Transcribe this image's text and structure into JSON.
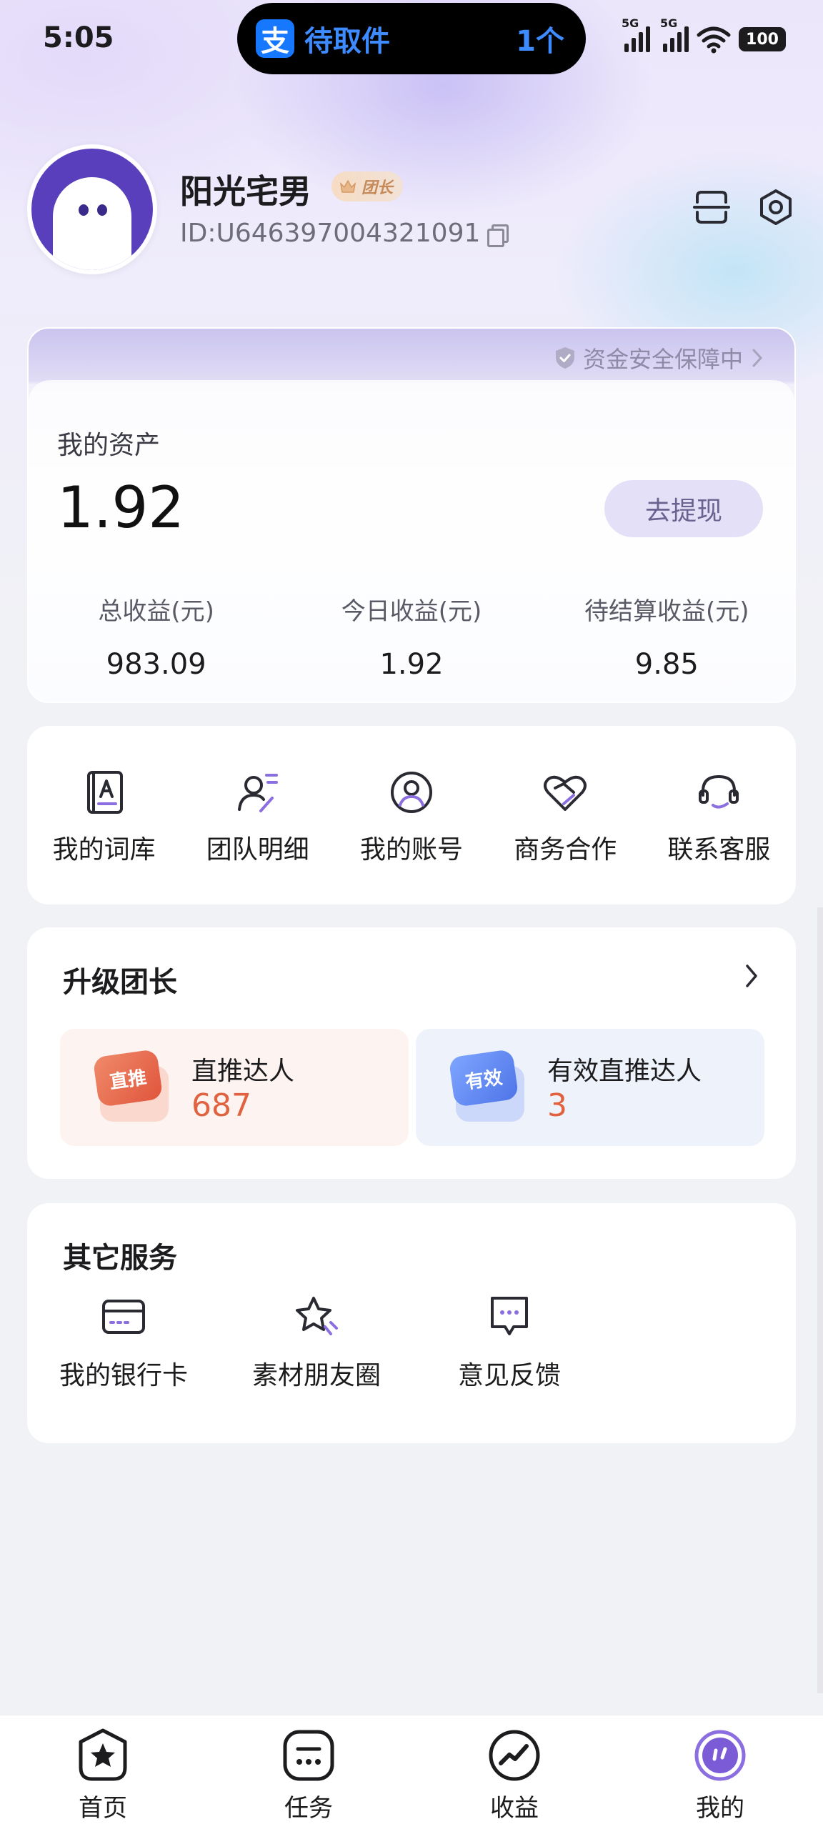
{
  "status_bar": {
    "time": "5:05",
    "island_title": "待取件",
    "island_count": "1个",
    "alipay_logo": "支",
    "network_5g_1": "5G",
    "network_5g_2": "5G",
    "battery": "100"
  },
  "profile": {
    "username": "阳光宅男",
    "badge": "团长",
    "user_id": "ID:U646397004321091"
  },
  "assets": {
    "safety_text": "资金安全保障中",
    "label": "我的资产",
    "value": "1.92",
    "withdraw_label": "去提现",
    "stats": [
      {
        "label": "总收益(元)",
        "value": "983.09"
      },
      {
        "label": "今日收益(元)",
        "value": "1.92"
      },
      {
        "label": "待结算收益(元)",
        "value": "9.85"
      }
    ]
  },
  "quick_menu": [
    {
      "label": "我的词库",
      "icon": "dictionary-icon"
    },
    {
      "label": "团队明细",
      "icon": "team-icon"
    },
    {
      "label": "我的账号",
      "icon": "account-icon"
    },
    {
      "label": "商务合作",
      "icon": "handshake-heart-icon"
    },
    {
      "label": "联系客服",
      "icon": "headset-icon"
    }
  ],
  "upgrade": {
    "title": "升级团长",
    "tiles": [
      {
        "badge": "直推",
        "label": "直推达人",
        "value": "687"
      },
      {
        "badge": "有效",
        "label": "有效直推达人",
        "value": "3"
      }
    ]
  },
  "services": {
    "title": "其它服务",
    "items": [
      {
        "label": "我的银行卡",
        "icon": "bank-card-icon"
      },
      {
        "label": "素材朋友圈",
        "icon": "star-moments-icon"
      },
      {
        "label": "意见反馈",
        "icon": "feedback-icon"
      }
    ]
  },
  "bottom_nav": [
    {
      "label": "首页",
      "icon": "home-star-icon"
    },
    {
      "label": "任务",
      "icon": "task-icon"
    },
    {
      "label": "收益",
      "icon": "earnings-icon"
    },
    {
      "label": "我的",
      "icon": "me-icon",
      "active": true
    }
  ],
  "colors": {
    "accent": "#7b5cd6",
    "value_orange": "#e0623f",
    "page_bg": "#f1f2f6"
  }
}
